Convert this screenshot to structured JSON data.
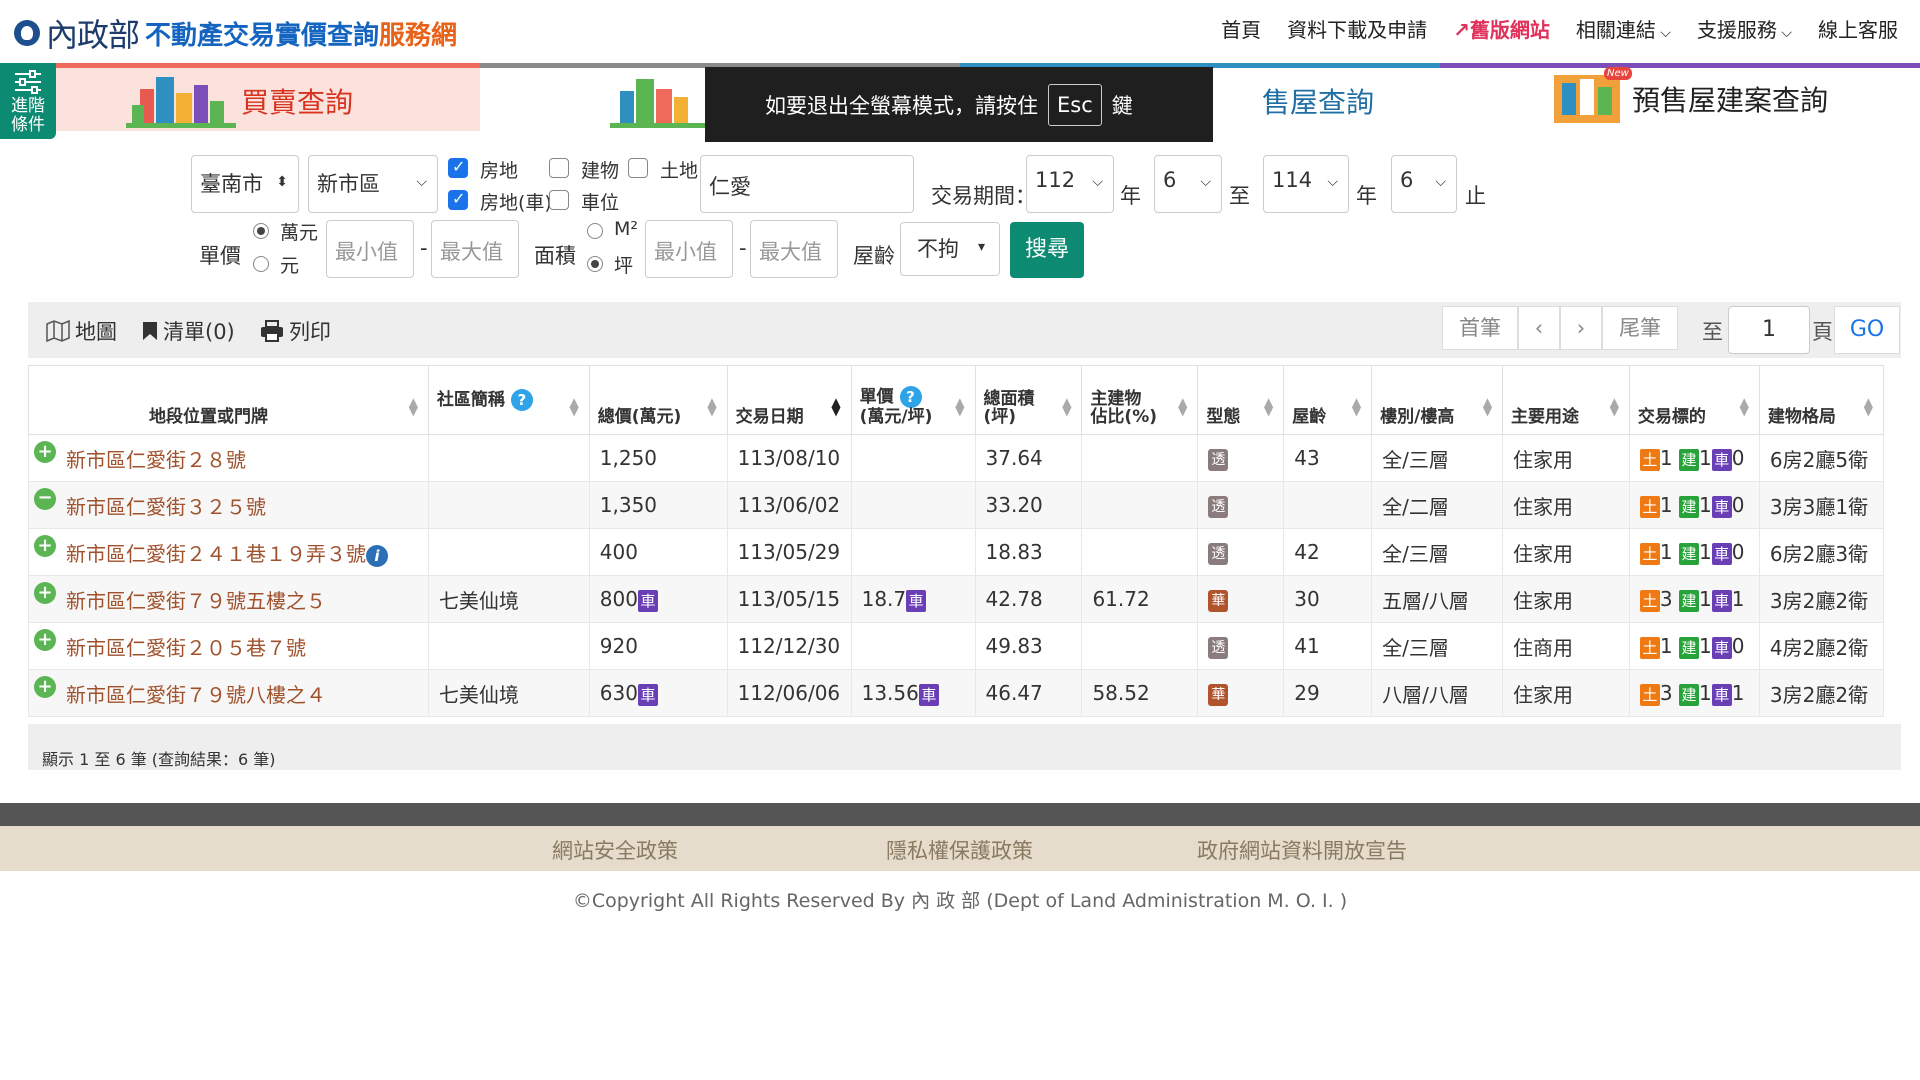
{
  "header": {
    "ministry": "內政部",
    "site_title_main": "不動產交易實價查詢",
    "site_title_accent": "服務網",
    "nav": [
      {
        "label": "首頁"
      },
      {
        "label": "資料下載及申請"
      },
      {
        "label": "舊版網站"
      },
      {
        "label": "相關連結"
      },
      {
        "label": "支援服務"
      },
      {
        "label": "線上客服"
      }
    ]
  },
  "advanced": {
    "line1": "進階",
    "line2": "條件"
  },
  "tabs": [
    {
      "label": "買賣查詢",
      "color": "#ef6a5a"
    },
    {
      "label": "",
      "color": "#8a8a8a"
    },
    {
      "label": "售屋查詢",
      "color": "#2f8fc1"
    },
    {
      "label": "預售屋建案查詢",
      "color": "#7c4fb8"
    }
  ],
  "tab_badge": "New",
  "toast": {
    "pre": "如要退出全螢幕模式，請按住",
    "key": "Esc",
    "post": "鍵"
  },
  "form": {
    "city": "臺南市",
    "district": "新市區",
    "chk_house_land": "房地",
    "chk_house_land_car": "房地(車)",
    "chk_building": "建物",
    "chk_land": "土地",
    "chk_parking": "車位",
    "keyword": "仁愛",
    "period_label": "交易期間：",
    "start_year": "112",
    "start_month": "6",
    "end_year": "114",
    "end_month": "6",
    "year_text": "年",
    "to_text": "至",
    "end_text": "止",
    "unit_price_label": "單價",
    "unit_wan": "萬元",
    "unit_yuan": "元",
    "min_placeholder": "最小值",
    "max_placeholder": "最大值",
    "dash": "-",
    "area_label": "面積",
    "area_m2": "M²",
    "area_ping": "坪",
    "age_label": "屋齡",
    "age_value": "不拘",
    "search": "搜尋"
  },
  "toolbar": {
    "map": "地圖",
    "list": "清單(0)",
    "print": "列印",
    "first": "首筆",
    "last": "尾筆",
    "to": "至",
    "page": "1",
    "page_unit": "頁",
    "go": "GO"
  },
  "table": {
    "headers": [
      "地段位置或門牌",
      "社區簡稱",
      "總價(萬元)",
      "交易日期",
      "單價",
      "(萬元/坪)",
      "總面積",
      "(坪)",
      "主建物",
      "佔比(%)",
      "型態",
      "屋齡",
      "樓別/樓高",
      "主要用途",
      "交易標的",
      "建物格局"
    ],
    "rows": [
      {
        "addr": "新市區仁愛街２８號",
        "community": "",
        "total": "1,250",
        "car": "",
        "date": "113/08/10",
        "unit": "",
        "unit_car": "",
        "area": "37.64",
        "main": "",
        "type": "透",
        "age": "43",
        "floor": "全/三層",
        "use": "住家用",
        "land": "1",
        "bld": "1",
        "park": "0",
        "layout": "6房2廳5衛",
        "sign": "+"
      },
      {
        "addr": "新市區仁愛街３２５號",
        "community": "",
        "total": "1,350",
        "car": "",
        "date": "113/06/02",
        "unit": "",
        "unit_car": "",
        "area": "33.20",
        "main": "",
        "type": "透",
        "age": "",
        "floor": "全/二層",
        "use": "住家用",
        "land": "1",
        "bld": "1",
        "park": "0",
        "layout": "3房3廳1衛",
        "sign": "−"
      },
      {
        "addr": "新市區仁愛街２４１巷１９弄３號",
        "community": "",
        "total": "400",
        "car": "",
        "date": "113/05/29",
        "unit": "",
        "unit_car": "",
        "area": "18.83",
        "main": "",
        "type": "透",
        "age": "42",
        "floor": "全/三層",
        "use": "住家用",
        "land": "1",
        "bld": "1",
        "park": "0",
        "layout": "6房2廳3衛",
        "sign": "+"
      },
      {
        "addr": "新市區仁愛街７９號五樓之５",
        "community": "七美仙境",
        "total": "800",
        "car": "車",
        "date": "113/05/15",
        "unit": "18.7",
        "unit_car": "車",
        "area": "42.78",
        "main": "61.72",
        "type": "華",
        "age": "30",
        "floor": "五層/八層",
        "use": "住家用",
        "land": "3",
        "bld": "1",
        "park": "1",
        "layout": "3房2廳2衛",
        "sign": "+"
      },
      {
        "addr": "新市區仁愛街２０５巷７號",
        "community": "",
        "total": "920",
        "car": "",
        "date": "112/12/30",
        "unit": "",
        "unit_car": "",
        "area": "49.83",
        "main": "",
        "type": "透",
        "age": "41",
        "floor": "全/三層",
        "use": "住商用",
        "land": "1",
        "bld": "1",
        "park": "0",
        "layout": "4房2廳2衛",
        "sign": "+"
      },
      {
        "addr": "新市區仁愛街７９號八樓之４",
        "community": "七美仙境",
        "total": "630",
        "car": "車",
        "date": "112/06/06",
        "unit": "13.56",
        "unit_car": "車",
        "area": "46.47",
        "main": "58.52",
        "type": "華",
        "age": "29",
        "floor": "八層/八層",
        "use": "住家用",
        "land": "3",
        "bld": "1",
        "park": "1",
        "layout": "3房2廳2衛",
        "sign": "+"
      }
    ],
    "badge_land": "土",
    "badge_bld": "建",
    "badge_park": "車"
  },
  "summary": "顯示 1 至 6 筆 (查詢結果：6 筆)",
  "footer": {
    "links": [
      "網站安全政策",
      "隱私權保護政策",
      "政府網站資料開放宣告"
    ],
    "copyright": "©Copyright All Rights Reserved By 內 政 部 (Dept of Land Administration M. O. I. )"
  }
}
